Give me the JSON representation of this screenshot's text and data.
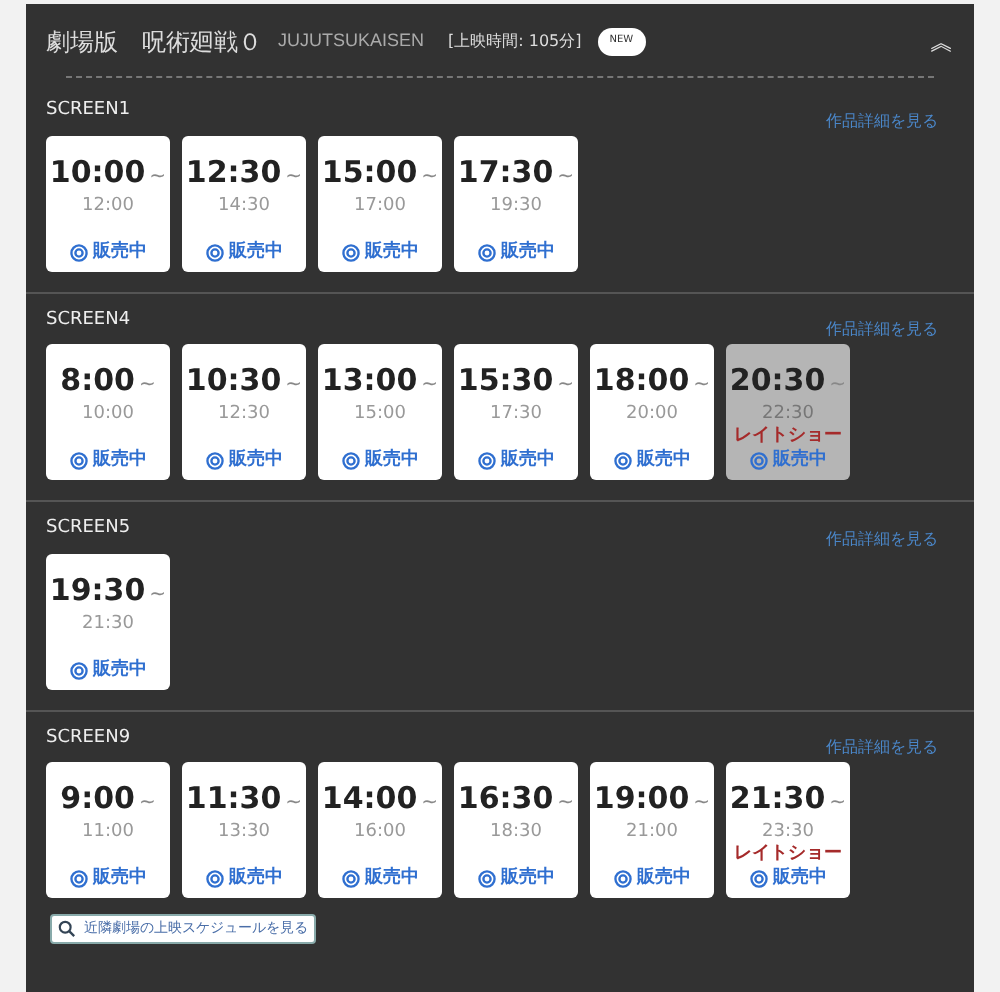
{
  "header": {
    "title": "劇場版　呪術廻戦０",
    "subtitle": "JUJUTSUKAISEN",
    "runtime": "[上映時間: 105分]",
    "badge": "NEW",
    "collapse_icon": "︽"
  },
  "screens": [
    {
      "name": "SCREEN1",
      "link": "作品詳細を見る",
      "shows": [
        {
          "start": "10:00",
          "tilde": "~",
          "end": "12:00",
          "status": "販売中",
          "dimmed": false
        },
        {
          "start": "12:30",
          "tilde": "~",
          "end": "14:30",
          "status": "販売中",
          "dimmed": false
        },
        {
          "start": "15:00",
          "tilde": "~",
          "end": "17:00",
          "status": "販売中",
          "dimmed": false
        },
        {
          "start": "17:30",
          "tilde": "~",
          "end": "19:30",
          "status": "販売中",
          "dimmed": false
        }
      ]
    },
    {
      "name": "SCREEN4",
      "link": "作品詳細を見る",
      "shows": [
        {
          "start": "8:00",
          "tilde": "~",
          "end": "10:00",
          "status": "販売中",
          "dimmed": false
        },
        {
          "start": "10:30",
          "tilde": "~",
          "end": "12:30",
          "status": "販売中",
          "dimmed": false
        },
        {
          "start": "13:00",
          "tilde": "~",
          "end": "15:00",
          "status": "販売中",
          "dimmed": false
        },
        {
          "start": "15:30",
          "tilde": "~",
          "end": "17:30",
          "status": "販売中",
          "dimmed": false
        },
        {
          "start": "18:00",
          "tilde": "~",
          "end": "20:00",
          "status": "販売中",
          "dimmed": false
        },
        {
          "start": "20:30",
          "tilde": "~",
          "end": "22:30",
          "note": "レイトショー",
          "status": "販売中",
          "dimmed": true
        }
      ]
    },
    {
      "name": "SCREEN5",
      "link": "作品詳細を見る",
      "shows": [
        {
          "start": "19:30",
          "tilde": "~",
          "end": "21:30",
          "status": "販売中",
          "dimmed": false
        }
      ]
    },
    {
      "name": "SCREEN9",
      "link": "作品詳細を見る",
      "shows": [
        {
          "start": "9:00",
          "tilde": "~",
          "end": "11:00",
          "status": "販売中",
          "dimmed": false
        },
        {
          "start": "11:30",
          "tilde": "~",
          "end": "13:30",
          "status": "販売中",
          "dimmed": false
        },
        {
          "start": "14:00",
          "tilde": "~",
          "end": "16:00",
          "status": "販売中",
          "dimmed": false
        },
        {
          "start": "16:30",
          "tilde": "~",
          "end": "18:30",
          "status": "販売中",
          "dimmed": false
        },
        {
          "start": "19:00",
          "tilde": "~",
          "end": "21:00",
          "status": "販売中",
          "dimmed": false
        },
        {
          "start": "21:30",
          "tilde": "~",
          "end": "23:30",
          "note": "レイトショー",
          "status": "販売中",
          "dimmed": false
        }
      ]
    }
  ],
  "nearby_button": "近隣劇場の上映スケジュールを見る"
}
